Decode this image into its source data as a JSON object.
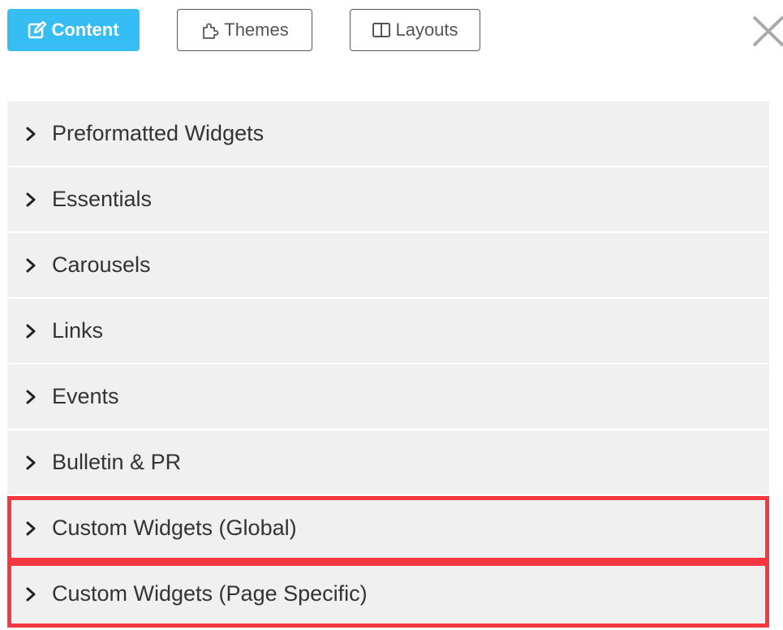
{
  "toolbar": {
    "tabs": [
      {
        "label": "Content",
        "icon": "edit-icon",
        "active": true
      },
      {
        "label": "Themes",
        "icon": "puzzle-icon",
        "active": false
      },
      {
        "label": "Layouts",
        "icon": "columns-icon",
        "active": false
      }
    ],
    "close_icon": "close-icon"
  },
  "colors": {
    "accent": "#35bdf4",
    "highlight": "#f5373f",
    "row_background": "#f0f0f0",
    "text": "#333333"
  },
  "sections": [
    {
      "label": "Preformatted Widgets",
      "highlighted": false
    },
    {
      "label": "Essentials",
      "highlighted": false
    },
    {
      "label": "Carousels",
      "highlighted": false
    },
    {
      "label": "Links",
      "highlighted": false
    },
    {
      "label": "Events",
      "highlighted": false
    },
    {
      "label": "Bulletin & PR",
      "highlighted": false
    },
    {
      "label": "Custom Widgets (Global)",
      "highlighted": true
    },
    {
      "label": "Custom Widgets (Page Specific)",
      "highlighted": true
    }
  ]
}
